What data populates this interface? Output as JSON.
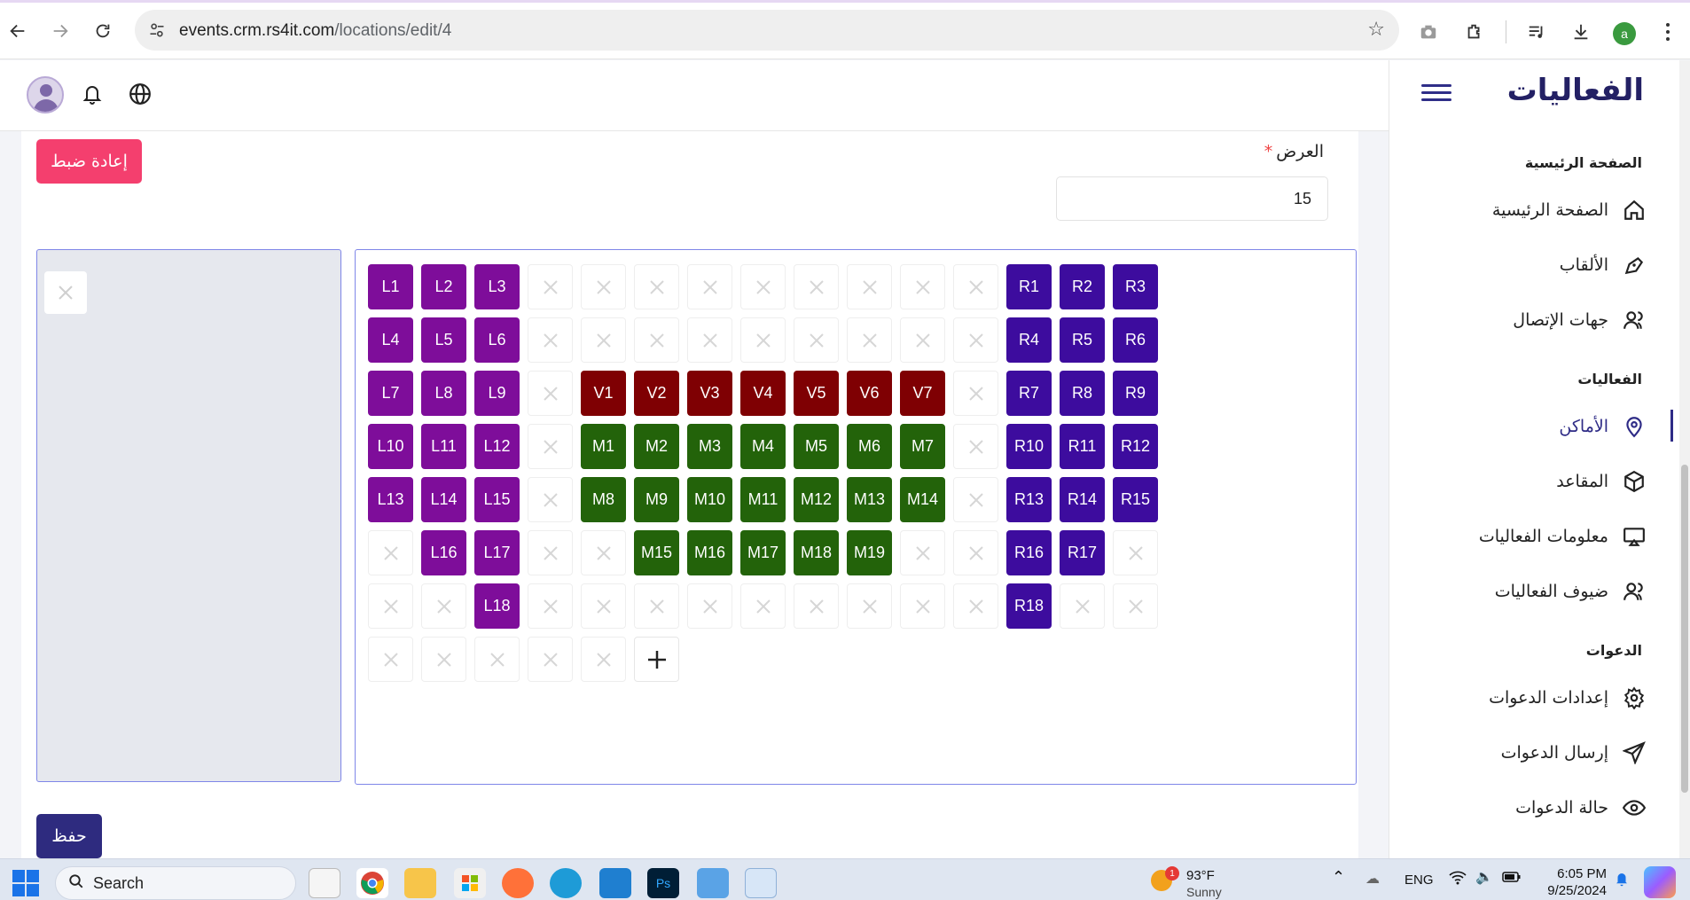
{
  "browser": {
    "url_host": "events.crm.rs4it.com",
    "url_path": "/locations/edit/4",
    "profile_initial": "a"
  },
  "sidebar": {
    "brand": "الفعاليات",
    "sections": [
      {
        "title": "الصفحة الرئيسية",
        "items": [
          {
            "label": "الصفحة الرئيسية",
            "icon": "home-icon"
          },
          {
            "label": "الألقاب",
            "icon": "pen-icon"
          },
          {
            "label": "جهات الإتصال",
            "icon": "users-icon"
          }
        ]
      },
      {
        "title": "الفعاليات",
        "items": [
          {
            "label": "الأماكن",
            "icon": "location-pin-icon",
            "active": true
          },
          {
            "label": "المقاعد",
            "icon": "cube-icon"
          },
          {
            "label": "معلومات الفعاليات",
            "icon": "screen-icon"
          },
          {
            "label": "ضيوف الفعاليات",
            "icon": "users-icon"
          }
        ]
      },
      {
        "title": "الدعوات",
        "items": [
          {
            "label": "إعدادات الدعوات",
            "icon": "gear-icon"
          },
          {
            "label": "إرسال الدعوات",
            "icon": "send-icon"
          },
          {
            "label": "حالة الدعوات",
            "icon": "eye-icon"
          }
        ]
      }
    ]
  },
  "form": {
    "reset_label": "إعادة ضبط",
    "width_label": "العرض",
    "required_mark": "*",
    "width_value": "15",
    "save_label": "حفظ"
  },
  "grid": {
    "columns": 15,
    "rows": [
      [
        "L1",
        "L2",
        "L3",
        "",
        "",
        "",
        "",
        "",
        "",
        "",
        "",
        "",
        "R1",
        "R2",
        "R3"
      ],
      [
        "L4",
        "L5",
        "L6",
        "",
        "",
        "",
        "",
        "",
        "",
        "",
        "",
        "",
        "R4",
        "R5",
        "R6"
      ],
      [
        "L7",
        "L8",
        "L9",
        "",
        "V1",
        "V2",
        "V3",
        "V4",
        "V5",
        "V6",
        "V7",
        "",
        "R7",
        "R8",
        "R9"
      ],
      [
        "L10",
        "L11",
        "L12",
        "",
        "M1",
        "M2",
        "M3",
        "M4",
        "M5",
        "M6",
        "M7",
        "",
        "R10",
        "R11",
        "R12"
      ],
      [
        "L13",
        "L14",
        "L15",
        "",
        "M8",
        "M9",
        "M10",
        "M11",
        "M12",
        "M13",
        "M14",
        "",
        "R13",
        "R14",
        "R15"
      ],
      [
        "",
        "L16",
        "L17",
        "",
        "",
        "M15",
        "M16",
        "M17",
        "M18",
        "M19",
        "",
        "",
        "R16",
        "R17",
        ""
      ],
      [
        "",
        "",
        "L18",
        "",
        "",
        "",
        "",
        "",
        "",
        "",
        "",
        "",
        "R18",
        "",
        ""
      ],
      [
        "",
        "",
        "",
        "",
        "",
        "+"
      ]
    ],
    "colors": {
      "L": "#7e0d9a",
      "R": "#3d0c9e",
      "V": "#7f0003",
      "M": "#23630a"
    }
  },
  "taskbar": {
    "search_label": "Search",
    "weather_temp": "93°F",
    "weather_desc": "Sunny",
    "weather_badge": "1",
    "lang": "ENG",
    "time": "6:05 PM",
    "date": "9/25/2024"
  }
}
